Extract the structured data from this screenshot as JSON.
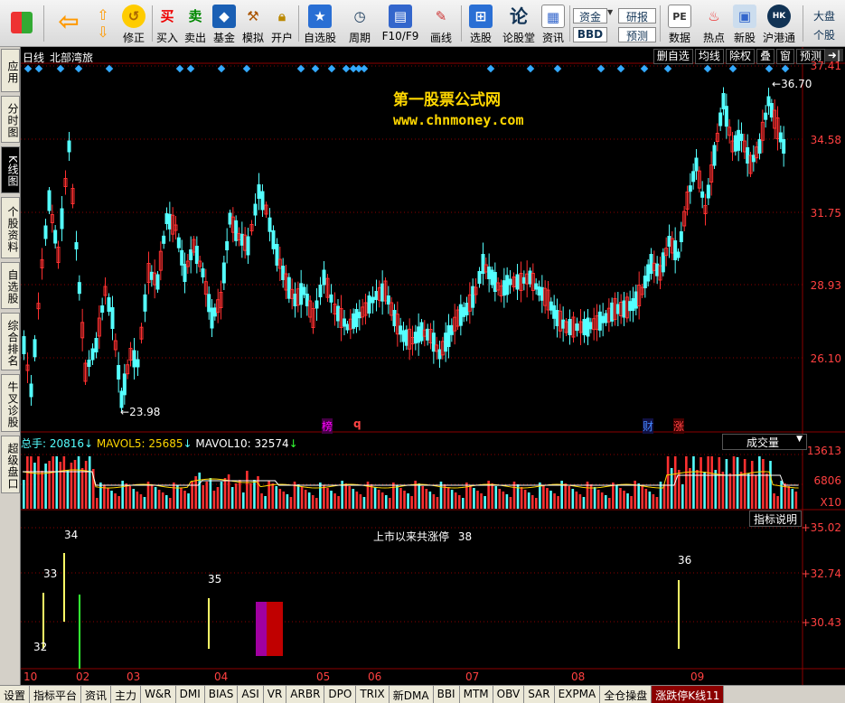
{
  "toolbar": {
    "buttons": [
      {
        "label": "",
        "icon": "windows-logo-icon"
      },
      {
        "label": "",
        "icon": "back-arrow-icon"
      },
      {
        "label": "修正",
        "icon": "rewind-icon"
      },
      {
        "label": "买入",
        "icon": "buy-icon",
        "glyph": "买"
      },
      {
        "label": "卖出",
        "icon": "sell-icon",
        "glyph": "卖"
      },
      {
        "label": "基金",
        "icon": "fund-icon"
      },
      {
        "label": "模拟",
        "icon": "hammer-icon"
      },
      {
        "label": "开户",
        "icon": "lock-icon"
      },
      {
        "label": "自选股",
        "icon": "star-icon"
      },
      {
        "label": "周期",
        "icon": "clock-icon"
      },
      {
        "label": "F10/F9",
        "icon": "report-icon"
      },
      {
        "label": "画线",
        "icon": "pencil-icon"
      },
      {
        "label": "选股",
        "icon": "select-stock-icon"
      },
      {
        "label": "论股堂",
        "icon": "forum-icon",
        "glyph": "论"
      },
      {
        "label": "资讯",
        "icon": "news-icon"
      },
      {
        "label": "资金",
        "icon": "money-icon"
      },
      {
        "label": "BBD",
        "icon": "bbd-icon"
      },
      {
        "label": "研报",
        "icon": "research-icon"
      },
      {
        "label": "预测",
        "icon": "forecast-icon"
      },
      {
        "label": "数据",
        "icon": "pe-icon",
        "glyph": "PE"
      },
      {
        "label": "热点",
        "icon": "hot-icon"
      },
      {
        "label": "新股",
        "icon": "new-stock-icon"
      },
      {
        "label": "沪港通",
        "icon": "hk-connect-icon"
      },
      {
        "label": "大盘",
        "icon": "index-icon"
      },
      {
        "label": "个股",
        "icon": "stock-icon"
      }
    ]
  },
  "left_tabs": [
    "应用",
    "分时图",
    "K线图",
    "个股资料",
    "自选股",
    "综合排名",
    "牛叉诊股",
    "超级盘口"
  ],
  "chart_header": {
    "period": "日线",
    "stock_name": "北部湾旅",
    "buttons": [
      "删自选",
      "均线",
      "除权",
      "叠",
      "窗",
      "预测"
    ]
  },
  "watermark": {
    "line1": "第一股票公式网",
    "line2": "www.chnmoney.com"
  },
  "price_axis": [
    "37.41",
    "34.58",
    "31.75",
    "28.93",
    "26.10"
  ],
  "price_annotations": {
    "high": "36.70",
    "low": "23.98"
  },
  "event_marks": [
    {
      "text": "榜",
      "color": "#ff00ff"
    },
    {
      "text": "q",
      "color": "#ff4040"
    },
    {
      "text": "财",
      "color": "#4080ff"
    },
    {
      "text": "涨",
      "color": "#ff4040"
    }
  ],
  "volume_panel": {
    "label_total": "总手: 20816",
    "label_mavol5": "MAVOL5: 25685",
    "label_mavol10": "MAVOL10: 32574",
    "selector": "成交量",
    "axis": [
      "13613",
      "6806",
      "X10"
    ]
  },
  "indicator_panel": {
    "explain_button": "指标说明",
    "title": "上市以来共涨停",
    "count": "38",
    "axis": [
      "+35.02",
      "+32.74",
      "+30.43"
    ],
    "bar_labels": [
      "32",
      "33",
      "34",
      "35",
      "36"
    ]
  },
  "x_axis_months": [
    "10",
    "02",
    "03",
    "04",
    "05",
    "06",
    "07",
    "08",
    "09"
  ],
  "bottom_tabs": [
    "设置",
    "指标平台",
    "资讯",
    "主力",
    "W&R",
    "DMI",
    "BIAS",
    "ASI",
    "VR",
    "ARBR",
    "DPO",
    "TRIX",
    "新DMA",
    "BBI",
    "MTM",
    "OBV",
    "SAR",
    "EXPMA",
    "全仓操盘",
    "涨跌停K线11"
  ],
  "colors": {
    "up": "#ff3030",
    "down": "#54ffff",
    "grid": "#8b0000",
    "accent": "#ffd700"
  },
  "chart_data": {
    "type": "candlestick",
    "price_range": [
      23.5,
      37.6
    ],
    "high": 36.7,
    "low": 23.98
  }
}
